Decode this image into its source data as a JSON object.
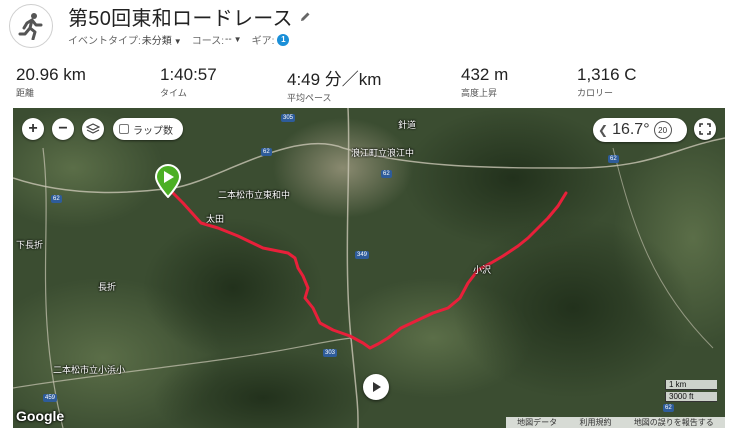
{
  "header": {
    "title": "第50回東和ロードレース",
    "event_type_label": "イベントタイプ:",
    "event_type_value": "未分類",
    "course_label": "コース:",
    "course_value": "--",
    "gear_label": "ギア:",
    "gear_count": "1"
  },
  "stats": [
    {
      "value": "20.96 km",
      "label": "距離"
    },
    {
      "value": "1:40:57",
      "label": "タイム"
    },
    {
      "value": "4:49 分／km",
      "label": "平均ペース"
    },
    {
      "value": "432 m",
      "label": "高度上昇"
    },
    {
      "value": "1,316 C",
      "label": "カロリー"
    }
  ],
  "map": {
    "zoom_in": "+",
    "zoom_out": "−",
    "lap_toggle_label": "ラップ数",
    "temperature": "16.7°",
    "wind_value": "20",
    "labels": {
      "harigi": "針道",
      "namie_school": "浪江町立浪江中",
      "towa_school": "二本松市立東和中",
      "ota": "太田",
      "shimonagaori": "下長折",
      "nagaori": "長折",
      "obama_school": "二本松市立小浜小",
      "ozawa": "小沢"
    },
    "road_shields": [
      "305",
      "62",
      "62",
      "62",
      "349",
      "303",
      "459",
      "62",
      "62"
    ],
    "scale_metric": "1 km",
    "scale_imperial": "3000 ft",
    "logo": "Google",
    "attribution": {
      "map_data": "地図データ",
      "terms": "利用規約",
      "report": "地図の誤りを報告する"
    }
  },
  "colors": {
    "route": "#e8203a",
    "start_marker": "#4caf24",
    "gear_badge": "#1a8fd8"
  },
  "icons": {
    "activity": "runner-icon",
    "edit": "pencil-icon",
    "layers": "layers-icon",
    "weather": "weather-icon",
    "fullscreen": "fullscreen-icon",
    "play": "play-icon",
    "start": "start-marker-icon"
  }
}
